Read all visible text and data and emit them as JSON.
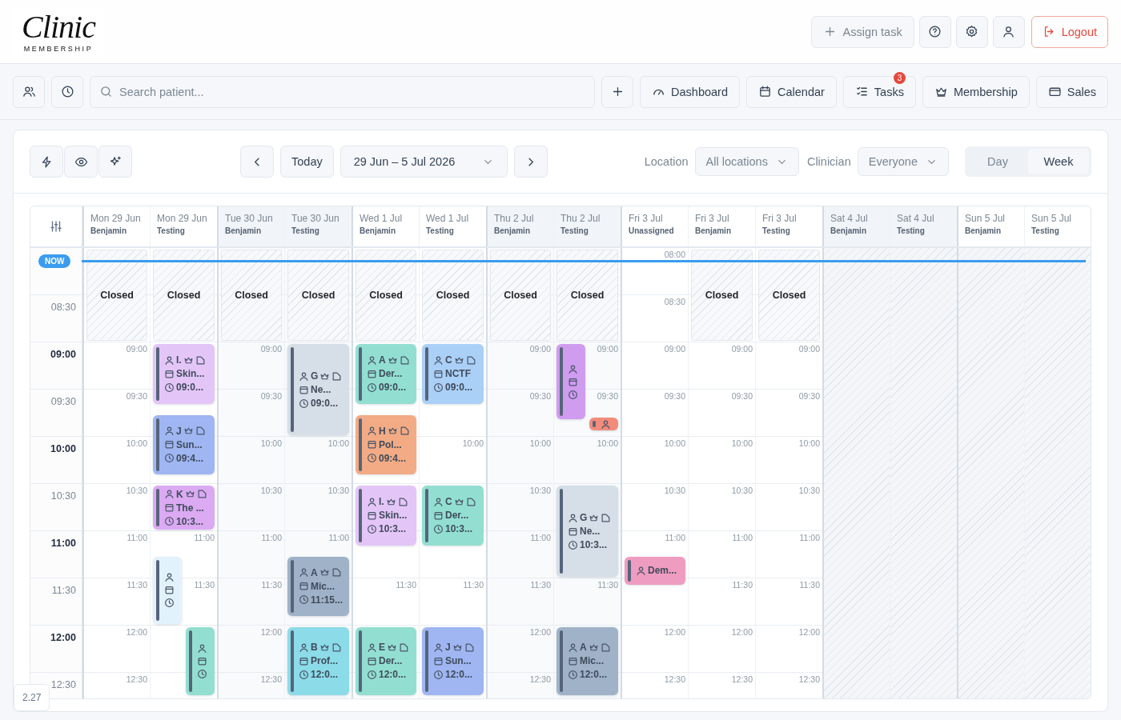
{
  "header": {
    "logo": {
      "script": "Clinic",
      "sub": "MEMBERSHIP"
    },
    "assign": "Assign task",
    "logout": "Logout"
  },
  "nav": {
    "search": {
      "placeholder": "Search patient..."
    },
    "items": [
      {
        "kind": "dashboard",
        "label": "Dashboard"
      },
      {
        "kind": "calendar",
        "label": "Calendar"
      },
      {
        "kind": "tasks",
        "label": "Tasks",
        "badge": "3"
      },
      {
        "kind": "membership",
        "label": "Membership"
      },
      {
        "kind": "sales",
        "label": "Sales"
      }
    ]
  },
  "toolbar": {
    "today": "Today",
    "range": "29 Jun – 5 Jul 2026",
    "location": {
      "label": "Location",
      "value": "All locations"
    },
    "clinician": {
      "label": "Clinician",
      "value": "Everyone"
    },
    "views": [
      {
        "label": "Day",
        "selected": false
      },
      {
        "label": "Week",
        "selected": true
      }
    ]
  },
  "now": {
    "label": "NOW"
  },
  "rows": [
    {
      "label": "08:30",
      "major": false
    },
    {
      "label": "09:00",
      "major": true
    },
    {
      "label": "09:30",
      "major": false
    },
    {
      "label": "10:00",
      "major": true
    },
    {
      "label": "10:30",
      "major": false
    },
    {
      "label": "11:00",
      "major": true
    },
    {
      "label": "11:30",
      "major": false
    },
    {
      "label": "12:00",
      "major": true
    },
    {
      "label": "12:30",
      "major": false
    }
  ],
  "columns": [
    {
      "day": "Mon 29 Jun",
      "clinician": "Benjamin",
      "day_start": true,
      "shaded": false,
      "closed": "Closed",
      "slots": [
        "09:00",
        "09:30",
        "10:00",
        "10:30",
        "11:00",
        "11:30",
        "12:00",
        "12:30"
      ]
    },
    {
      "day": "Mon 29 Jun",
      "clinician": "Testing",
      "day_start": false,
      "shaded": false,
      "closed": "Closed",
      "slots": [
        "11:00",
        "11:30"
      ],
      "appointments": [
        {
          "kind": "full",
          "color": "#e3c6f7",
          "initial": "I.",
          "service": "Skin...",
          "time": "09:0..."
        },
        {
          "kind": "full",
          "color": "#9fb6f2",
          "initial": "J",
          "service": "Sun...",
          "time": "09:4..."
        },
        {
          "kind": "full",
          "color": "#dbaaf2",
          "initial": "K",
          "service": "The ...",
          "time": "10:3..."
        },
        {
          "kind": "icons",
          "color": "#e2f2fc"
        },
        {
          "kind": "icons",
          "color": "#92dfd1"
        }
      ]
    },
    {
      "day": "Tue 30 Jun",
      "clinician": "Benjamin",
      "day_start": true,
      "shaded": true,
      "closed": "Closed",
      "slots": [
        "09:00",
        "09:30",
        "10:00",
        "10:30",
        "11:00",
        "11:30",
        "12:00",
        "12:30"
      ]
    },
    {
      "day": "Tue 30 Jun",
      "clinician": "Testing",
      "day_start": false,
      "shaded": true,
      "closed": "Closed",
      "slots": [
        "10:00",
        "10:30",
        "11:00"
      ],
      "appointments": [
        {
          "kind": "full",
          "color": "#d6dee7",
          "initial": "G",
          "service": "Ne...",
          "time": "09:0..."
        },
        {
          "kind": "full",
          "color": "#9fb2c8",
          "initial": "A",
          "service": "Mic...",
          "time": "11:15..."
        },
        {
          "kind": "full",
          "color": "#8cdbe8",
          "initial": "B",
          "service": "Prof...",
          "time": "12:0..."
        }
      ]
    },
    {
      "day": "Wed 1 Jul",
      "clinician": "Benjamin",
      "day_start": true,
      "shaded": false,
      "closed": "Closed",
      "slots": [
        "11:30"
      ],
      "appointments": [
        {
          "kind": "full",
          "color": "#92dfd1",
          "initial": "A",
          "service": "Der...",
          "time": "09:0..."
        },
        {
          "kind": "full",
          "color": "#f2ab84",
          "initial": "H",
          "service": "Pol...",
          "time": "09:4..."
        },
        {
          "kind": "full",
          "color": "#e3c6f7",
          "initial": "I.",
          "service": "Skin...",
          "time": "10:3..."
        },
        {
          "kind": "full",
          "color": "#92dfd1",
          "initial": "E",
          "service": "Der...",
          "time": "12:0..."
        }
      ]
    },
    {
      "day": "Wed 1 Jul",
      "clinician": "Testing",
      "day_start": false,
      "shaded": false,
      "closed": "Closed",
      "slots": [
        "10:00",
        "11:30"
      ],
      "appointments": [
        {
          "kind": "full",
          "color": "#abd0f7",
          "initial": "C",
          "service": "NCTF",
          "time": "09:0..."
        },
        {
          "kind": "full",
          "color": "#92dfd1",
          "initial": "C",
          "service": "Der...",
          "time": "10:3..."
        },
        {
          "kind": "full",
          "color": "#9fb6f2",
          "initial": "J",
          "service": "Sun...",
          "time": "12:0..."
        }
      ]
    },
    {
      "day": "Thu 2 Jul",
      "clinician": "Benjamin",
      "day_start": true,
      "shaded": true,
      "closed": "Closed",
      "slots": [
        "09:00",
        "09:30",
        "10:00",
        "10:30",
        "11:00",
        "11:30",
        "12:00",
        "12:30"
      ]
    },
    {
      "day": "Thu 2 Jul",
      "clinician": "Testing",
      "day_start": false,
      "shaded": true,
      "closed": "Closed",
      "slots": [
        "09:00",
        "09:30",
        "10:00",
        "11:30"
      ],
      "appointments": [
        {
          "kind": "icons",
          "color": "#cf9cf0"
        },
        {
          "kind": "dot",
          "color": "#f28b7b"
        },
        {
          "kind": "full",
          "color": "#d6dee7",
          "initial": "G",
          "service": "Ne...",
          "time": "10:3..."
        },
        {
          "kind": "full",
          "color": "#9fb2c8",
          "initial": "A",
          "service": "Mic...",
          "time": "12:0..."
        }
      ]
    },
    {
      "day": "Fri 3 Jul",
      "clinician": "Unassigned",
      "day_start": true,
      "shaded": false,
      "slots": [
        "08:00",
        "08:30",
        "09:00",
        "09:30",
        "10:00",
        "10:30",
        "11:00",
        "12:00",
        "12:30"
      ],
      "appointments": [
        {
          "kind": "compact",
          "color": "#ef9cc1",
          "service": "Dem..."
        }
      ]
    },
    {
      "day": "Fri 3 Jul",
      "clinician": "Benjamin",
      "day_start": false,
      "shaded": false,
      "closed": "Closed",
      "slots": [
        "09:00",
        "09:30",
        "10:00",
        "10:30",
        "11:00",
        "11:30",
        "12:00",
        "12:30"
      ]
    },
    {
      "day": "Fri 3 Jul",
      "clinician": "Testing",
      "day_start": false,
      "shaded": false,
      "closed": "Closed",
      "slots": [
        "09:00",
        "09:30",
        "10:00",
        "10:30",
        "11:00",
        "11:30",
        "12:00",
        "12:30"
      ]
    },
    {
      "day": "Sat 4 Jul",
      "clinician": "Benjamin",
      "day_start": true,
      "shaded": true,
      "off": true
    },
    {
      "day": "Sat 4 Jul",
      "clinician": "Testing",
      "day_start": false,
      "shaded": true,
      "off": true
    },
    {
      "day": "Sun 5 Jul",
      "clinician": "Benjamin",
      "day_start": true,
      "shaded": false,
      "off": true
    },
    {
      "day": "Sun 5 Jul",
      "clinician": "Testing",
      "day_start": false,
      "shaded": false,
      "off": true
    }
  ],
  "version": "2.27"
}
